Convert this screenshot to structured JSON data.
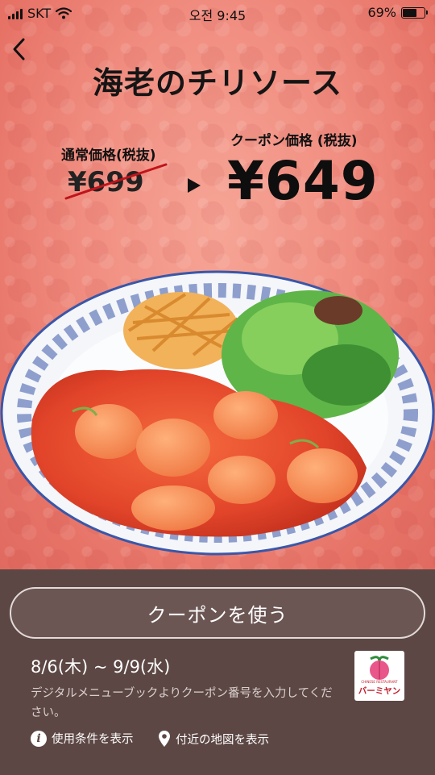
{
  "status_bar": {
    "carrier": "SKT",
    "time": "오전 9:45",
    "battery": "69%",
    "battery_level": 0.69
  },
  "header": {
    "title": "海老のチリソース"
  },
  "pricing": {
    "regular_label": "通常価格(税抜)",
    "regular_price": "¥699",
    "coupon_label": "クーポン価格 (税抜)",
    "coupon_price": "¥649"
  },
  "coupon": {
    "use_button_label": "クーポンを使う",
    "valid_period": "8/6(木) ~ 9/9(水)",
    "description": "デジタルメニューブックよりクーポン番号を入力してください。"
  },
  "brand": {
    "logo_text": "バーミヤン",
    "logo_subtext": "CHINESE RESTAURANT"
  },
  "links": {
    "terms_label": "使用条件を表示",
    "map_label": "付近の地図を表示"
  },
  "colors": {
    "hero_bg": "#f08d80",
    "panel_bg": "#5c4744",
    "brand_red": "#c21f2c"
  },
  "icons": {
    "back": "chevron-left-icon",
    "terms": "info-icon",
    "map": "map-pin-icon"
  }
}
